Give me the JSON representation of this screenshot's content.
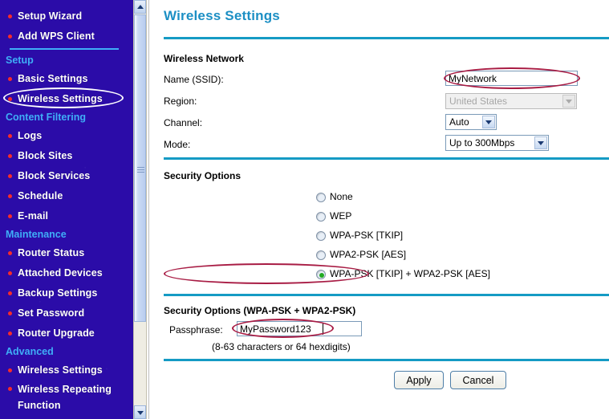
{
  "sidebar": {
    "top_items": [
      {
        "label": "Setup Wizard"
      },
      {
        "label": "Add WPS Client"
      }
    ],
    "groups": [
      {
        "section": "Setup",
        "items": [
          {
            "label": "Basic Settings",
            "highlighted": false
          },
          {
            "label": "Wireless Settings",
            "highlighted": true
          }
        ]
      },
      {
        "section": "Content Filtering",
        "items": [
          {
            "label": "Logs",
            "highlighted": false
          },
          {
            "label": "Block Sites",
            "highlighted": false
          },
          {
            "label": "Block Services",
            "highlighted": false
          },
          {
            "label": "Schedule",
            "highlighted": false
          },
          {
            "label": "E-mail",
            "highlighted": false
          }
        ]
      },
      {
        "section": "Maintenance",
        "items": [
          {
            "label": "Router Status",
            "highlighted": false
          },
          {
            "label": "Attached Devices",
            "highlighted": false
          },
          {
            "label": "Backup Settings",
            "highlighted": false
          },
          {
            "label": "Set Password",
            "highlighted": false
          },
          {
            "label": "Router Upgrade",
            "highlighted": false
          }
        ]
      },
      {
        "section": "Advanced",
        "items": [
          {
            "label": "Wireless Settings",
            "highlighted": false
          },
          {
            "label": "Wireless Repeating Function",
            "highlighted": false
          }
        ]
      }
    ]
  },
  "main": {
    "page_title": "Wireless Settings",
    "wireless_network": {
      "heading": "Wireless Network",
      "ssid_label": "Name (SSID):",
      "ssid_value": "MyNetwork",
      "region_label": "Region:",
      "region_value": "United States",
      "region_disabled": "true",
      "channel_label": "Channel:",
      "channel_value": "Auto",
      "mode_label": "Mode:",
      "mode_value": "Up to 300Mbps"
    },
    "security_options": {
      "heading": "Security Options",
      "options": [
        {
          "label": "None",
          "selected": false
        },
        {
          "label": "WEP",
          "selected": false
        },
        {
          "label": "WPA-PSK [TKIP]",
          "selected": false
        },
        {
          "label": "WPA2-PSK [AES]",
          "selected": false
        },
        {
          "label": "WPA-PSK [TKIP] + WPA2-PSK [AES]",
          "selected": true
        }
      ]
    },
    "passphrase_section": {
      "heading": "Security Options (WPA-PSK + WPA2-PSK)",
      "passphrase_label": "Passphrase:",
      "passphrase_value": "MyPassword123",
      "hint": "(8-63 characters or 64 hexdigits)"
    },
    "buttons": {
      "apply": "Apply",
      "cancel": "Cancel"
    }
  },
  "colors": {
    "sidebar_bg": "#2B0CA8",
    "sidebar_section": "#3FAEF7",
    "sidebar_bullet": "#F52B2B",
    "title_blue": "#1C8FC4",
    "divider": "#159BC4",
    "annotation_red": "#A81C44",
    "annotation_white": "#FFFFFF",
    "radio_selected": "#22AA22"
  }
}
